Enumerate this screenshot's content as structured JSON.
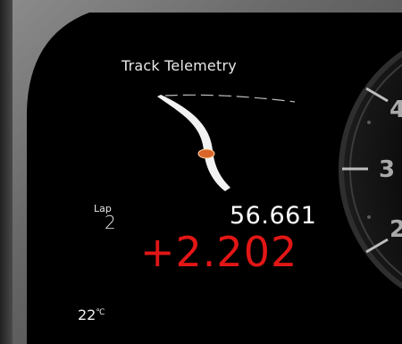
{
  "screen": {
    "title": "Track Telemetry",
    "lap": {
      "label": "Lap",
      "value": "2"
    },
    "lap_time": "56.661",
    "delta": "+2.202",
    "temperature": {
      "value": "22",
      "unit": "℃"
    }
  },
  "gauge": {
    "scale_labels": [
      "4",
      "3",
      "2"
    ]
  },
  "colors": {
    "screen_background": "#000000",
    "delta_text": "#e21616",
    "marker": "#d9652a",
    "bezel": "#6b6b6b"
  }
}
